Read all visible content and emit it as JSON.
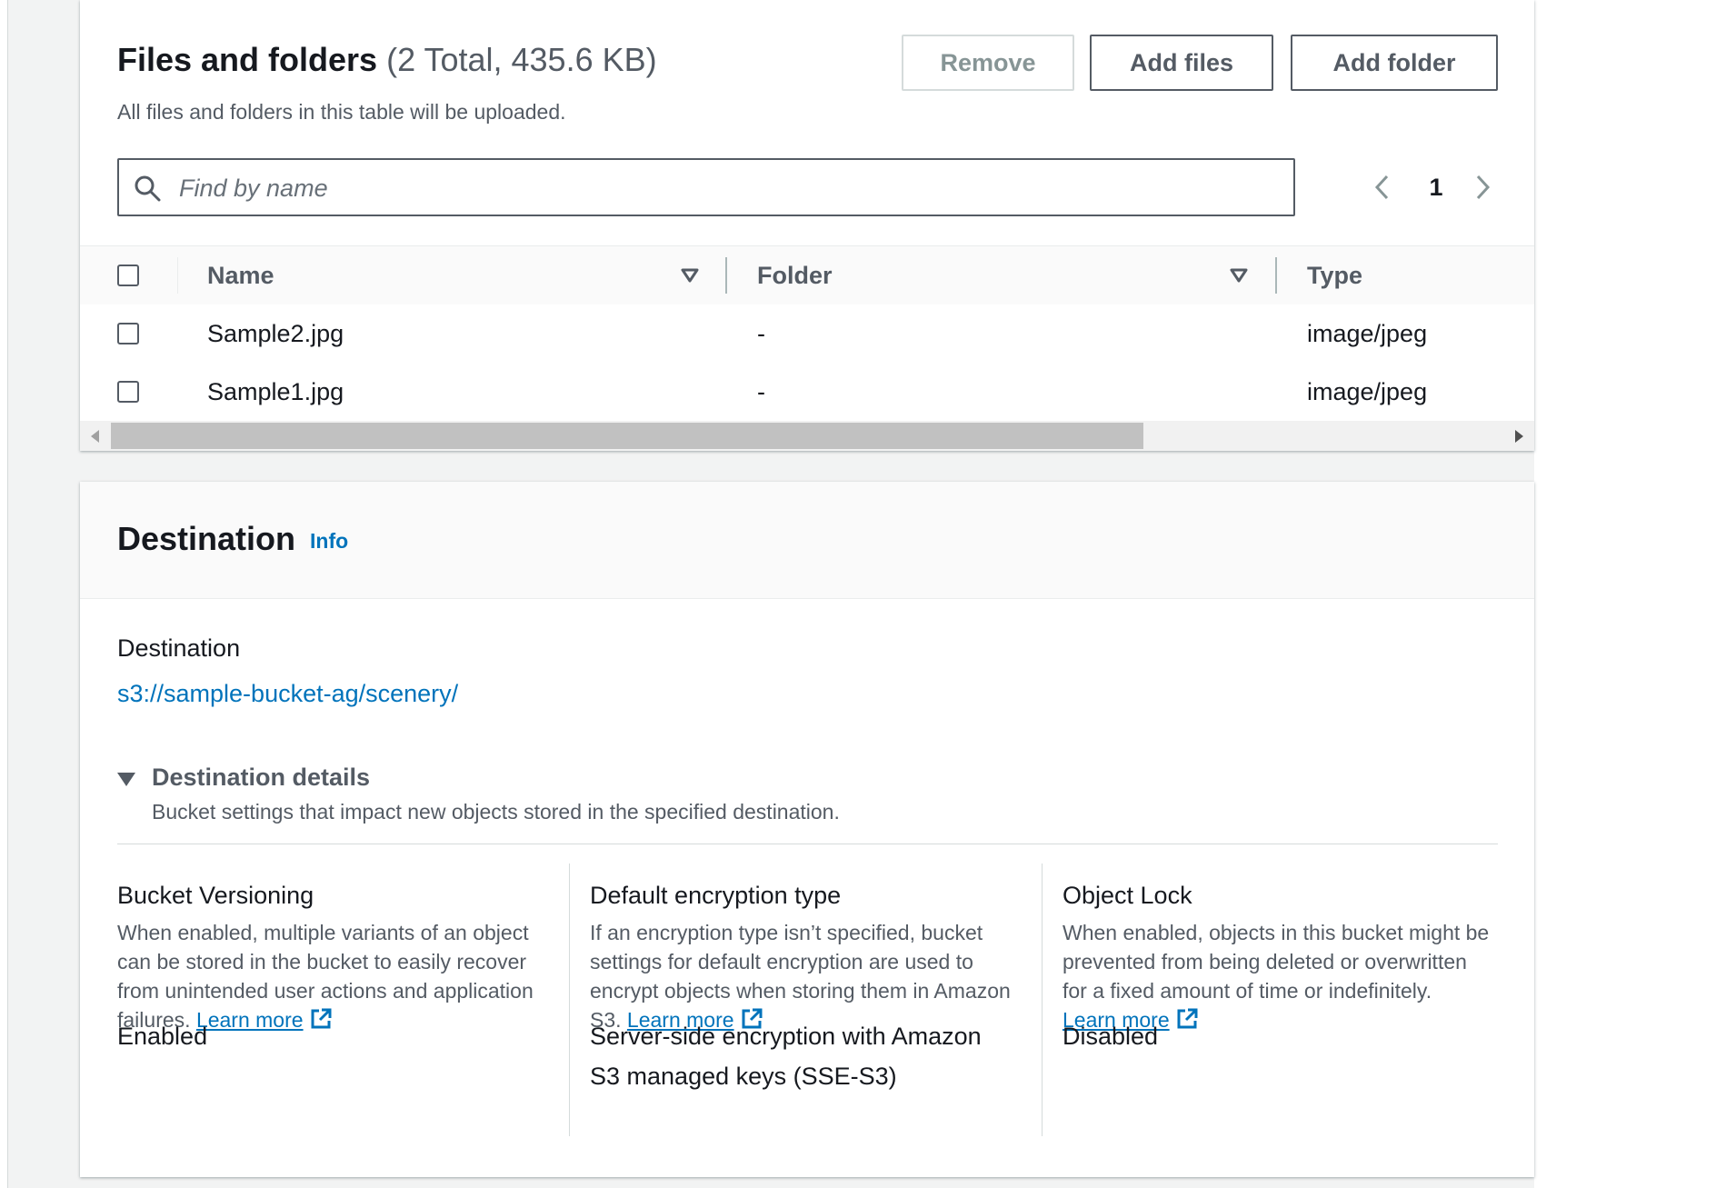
{
  "files": {
    "title": "Files and folders",
    "count": "(2 Total, 435.6 KB)",
    "description": "All files and folders in this table will be uploaded.",
    "buttons": {
      "remove": "Remove",
      "add_files": "Add files",
      "add_folder": "Add folder"
    },
    "search": {
      "placeholder": "Find by name",
      "value": ""
    },
    "pagination": {
      "current": "1"
    },
    "columns": [
      "Name",
      "Folder",
      "Type"
    ],
    "rows": [
      {
        "name": "Sample2.jpg",
        "folder": "-",
        "type": "image/jpeg"
      },
      {
        "name": "Sample1.jpg",
        "folder": "-",
        "type": "image/jpeg"
      }
    ]
  },
  "destination": {
    "title": "Destination",
    "info_link": "Info",
    "label": "Destination",
    "value": "s3://sample-bucket-ag/scenery/",
    "details": {
      "toggle_label": "Destination details",
      "description": "Bucket settings that impact new objects stored in the specified destination.",
      "learn_more": "Learn more",
      "columns": [
        {
          "title": "Bucket Versioning",
          "description": "When enabled, multiple variants of an object can be stored in the bucket to easily recover from unintended user actions and application failures.",
          "value": "Enabled"
        },
        {
          "title": "Default encryption type",
          "description": "If an encryption type isn’t specified, bucket settings for default encryption are used to encrypt objects when storing them in Amazon S3.",
          "value": "Server-side encryption with Amazon S3 managed keys (SSE-S3)"
        },
        {
          "title": "Object Lock",
          "description": "When enabled, objects in this bucket might be prevented from being deleted or overwritten for a fixed amount of time or indefinitely.",
          "value": "Disabled"
        }
      ]
    }
  },
  "icons": {
    "search": "search-icon",
    "sort": "caret-down-filled-icon",
    "pager_prev": "angle-left-icon",
    "pager_next": "angle-right-icon",
    "external": "external-link-icon",
    "expand": "caret-down-icon"
  },
  "colors": {
    "link": "#0073bb",
    "text": "#16191f",
    "secondary": "#545b64",
    "border": "#d5dbdb"
  }
}
